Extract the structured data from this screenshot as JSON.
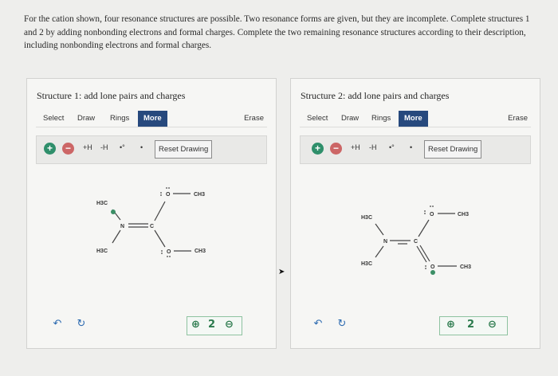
{
  "intro": "For the cation shown, four resonance structures are possible. Two resonance forms are given, but they are incomplete. Complete structures 1 and 2 by adding nonbonding electrons and formal charges. Complete the two remaining resonance structures according to their description, including nonbonding electrons and formal charges.",
  "panels": [
    {
      "title": "Structure 1: add lone pairs and charges",
      "toolbar": {
        "select": "Select",
        "draw": "Draw",
        "rings": "Rings",
        "more": "More",
        "erase": "Erase"
      },
      "tools": {
        "plus_h": "+H",
        "minus_h": "-H",
        "radical": "•°",
        "dot": "•",
        "reset": "Reset Drawing"
      },
      "molecule": {
        "h3c_top": "H3C",
        "h3c_bottom": "H3C",
        "n": "N",
        "c": "C",
        "o_top": "O",
        "o_bottom": "O",
        "ch3_top": "CH3",
        "ch3_bottom": "CH3"
      }
    },
    {
      "title": "Structure 2: add lone pairs and charges",
      "toolbar": {
        "select": "Select",
        "draw": "Draw",
        "rings": "Rings",
        "more": "More",
        "erase": "Erase"
      },
      "tools": {
        "plus_h": "+H",
        "minus_h": "-H",
        "radical": "•°",
        "dot": "•",
        "reset": "Reset Drawing"
      },
      "molecule": {
        "h3c_top": "H3C",
        "h3c_bottom": "H3C",
        "n": "N",
        "c": "C",
        "o_top": "O",
        "o_bottom": "O",
        "ch3_top": "CH3",
        "ch3_bottom": "CH3"
      }
    }
  ],
  "icons": {
    "add": "plus-circle-icon",
    "remove": "minus-circle-icon",
    "undo": "undo-icon",
    "redo": "redo-icon",
    "zoom_in": "zoom-in-icon",
    "zoom_reset": "zoom-reset-icon",
    "zoom_out": "zoom-out-icon"
  },
  "colors": {
    "more_button": "#27497d",
    "add_button": "#2f8f6b",
    "remove_button": "#cc6666",
    "zoom_border": "#8ec2a0"
  }
}
